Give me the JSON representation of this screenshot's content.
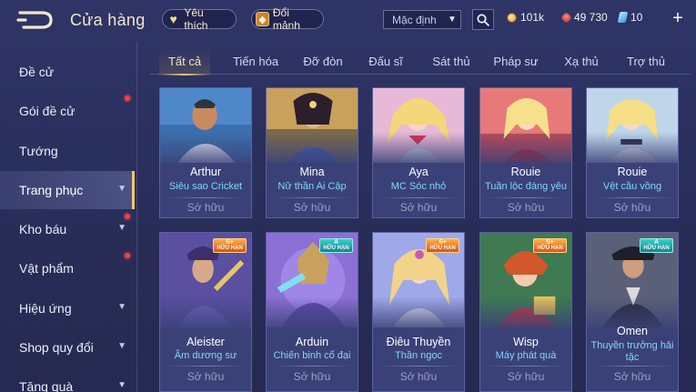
{
  "header": {
    "title": "Cửa hàng",
    "favorites_label": "Yêu thích",
    "exchange_label": "Đổi mảnh",
    "sort_value": "Mặc định",
    "gold": "101k",
    "vouchers": "49 730",
    "gems": "10"
  },
  "sidebar": {
    "items": [
      {
        "label": "Đề cử"
      },
      {
        "label": "Gói đề cử"
      },
      {
        "label": "Tướng"
      },
      {
        "label": "Trang phục"
      },
      {
        "label": "Kho báu"
      },
      {
        "label": "Vật phẩm"
      },
      {
        "label": "Hiệu ứng"
      },
      {
        "label": "Shop quy đổi"
      },
      {
        "label": "Tặng quà"
      }
    ]
  },
  "tabs": [
    "Tất cả",
    "Tiến hóa",
    "Đỡ đòn",
    "Đấu sĩ",
    "Sát thủ",
    "Pháp sư",
    "Xạ thủ",
    "Trợ thủ"
  ],
  "cards": [
    {
      "hero": "Arthur",
      "skin": "Siêu sao Cricket",
      "status": "Sở hữu"
    },
    {
      "hero": "Mina",
      "skin": "Nữ thần Ai Cập",
      "status": "Sở hữu"
    },
    {
      "hero": "Aya",
      "skin": "MC Sóc nhỏ",
      "status": "Sở hữu"
    },
    {
      "hero": "Rouie",
      "skin": "Tuần lộc đáng yêu",
      "status": "Sở hữu"
    },
    {
      "hero": "Rouie",
      "skin": "Vệt cầu vồng",
      "status": "Sở hữu"
    },
    {
      "hero": "Aleister",
      "skin": "Âm dương sư",
      "status": "Sở hữu",
      "badge": {
        "tier": "S+",
        "text": "HỮU HẠN"
      }
    },
    {
      "hero": "Arduin",
      "skin": "Chiến binh cổ đại",
      "status": "Sở hữu",
      "badge": {
        "tier": "A",
        "text": "HỮU HẠN"
      }
    },
    {
      "hero": "Điêu Thuyền",
      "skin": "Thần ngọc",
      "status": "Sở hữu",
      "badge": {
        "tier": "S+",
        "text": "HỮU HẠN"
      }
    },
    {
      "hero": "Wisp",
      "skin": "Máy phát quà",
      "status": "Sở hữu",
      "badge": {
        "tier": "S+",
        "text": "HỮU HẠN"
      }
    },
    {
      "hero": "Omen",
      "skin": "Thuyền trưởng hải tặc",
      "status": "Sở hữu",
      "badge": {
        "tier": "A",
        "text": "HỮU HẠN"
      }
    }
  ],
  "colors": {
    "background": "#2a2f5c",
    "accent_gold": "#f3c66a",
    "skin_name": "#7fd6ff",
    "notification": "#ff3b3b"
  }
}
